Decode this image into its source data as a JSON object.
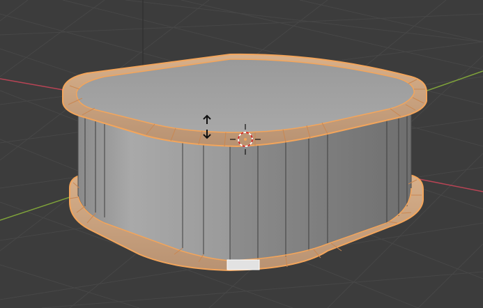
{
  "viewport": {
    "mode": "edit-mode",
    "background_color": "#3c3c3c",
    "grid_color": "#4a4a4a",
    "axis_x_color": "#c2465a",
    "axis_y_color": "#7fa33a",
    "axis_z_color": "#2d2d2d"
  },
  "mesh": {
    "object_type": "rounded-box-with-beveled-rims",
    "face_color": "#9d9d9d",
    "top_face_color": "#a7a7a7",
    "selection_color": "#f3a55b",
    "selection_edge_color": "#ffa500"
  },
  "gizmo": {
    "icon": "vertical-move-arrows-icon",
    "cursor_icon": "3d-cursor-icon"
  }
}
